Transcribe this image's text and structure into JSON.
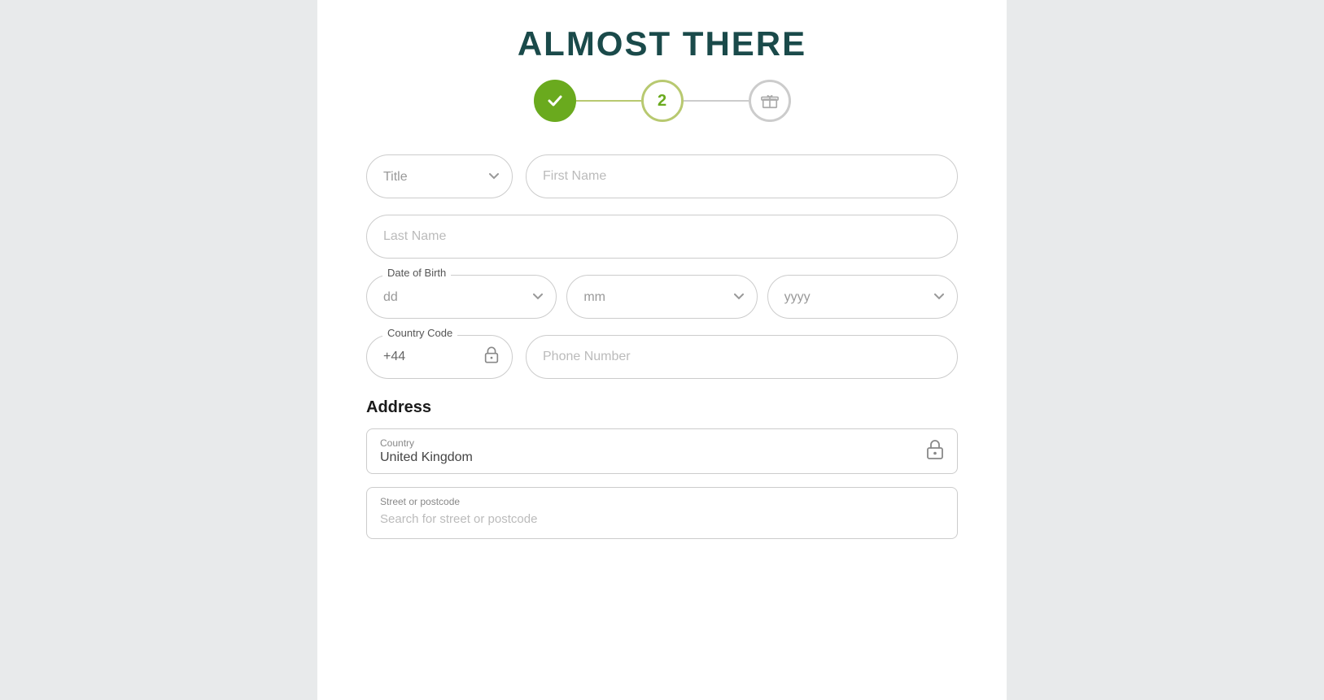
{
  "page": {
    "title": "ALMOST THERE",
    "background_left": "#e8eaeb",
    "background_main": "#ffffff",
    "background_right": "#e8eaeb"
  },
  "progress": {
    "step1": {
      "label": "✓",
      "state": "completed"
    },
    "step2": {
      "label": "2",
      "state": "active"
    },
    "step3": {
      "label": "gift",
      "state": "inactive"
    }
  },
  "form": {
    "title_placeholder": "Title",
    "firstname_placeholder": "First Name",
    "lastname_placeholder": "Last Name",
    "dob_label": "Date of Birth",
    "dob_dd": "dd",
    "dob_mm": "mm",
    "dob_yyyy": "yyyy",
    "country_code_label": "Country Code",
    "country_code_value": "+44",
    "phone_placeholder": "Phone Number",
    "address_title": "Address",
    "country_label": "Country",
    "country_value": "United Kingdom",
    "street_label": "Street or postcode",
    "street_placeholder": "Search for street or postcode"
  }
}
